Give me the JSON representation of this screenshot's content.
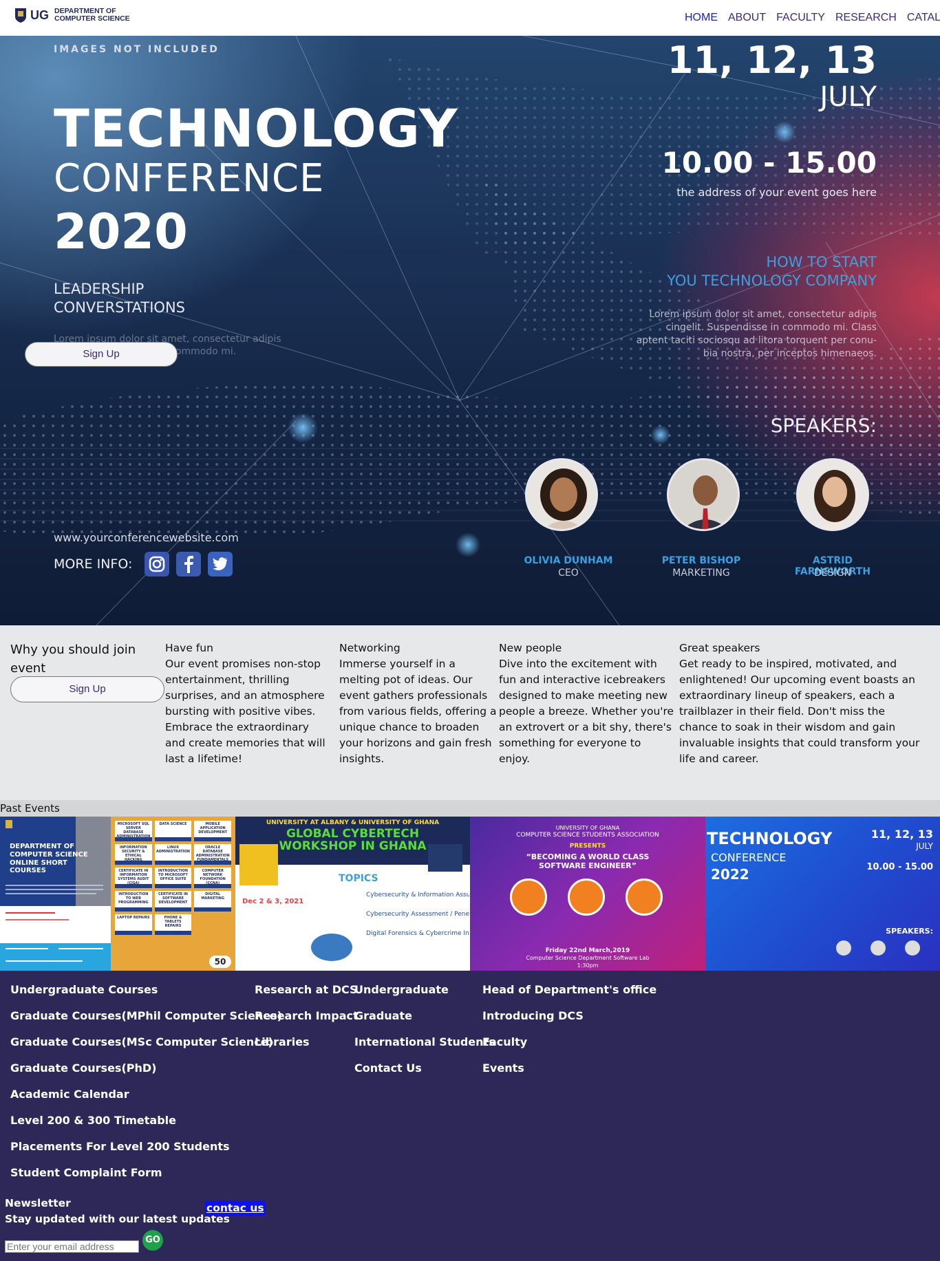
{
  "nav": {
    "logo_ug": "UG",
    "logo_line1": "DEPARTMENT OF",
    "logo_line2": "COMPUTER SCIENCE",
    "links": [
      "HOME",
      "ABOUT",
      "FACULTY",
      "RESEARCH",
      "CATALOG"
    ]
  },
  "hero": {
    "images_not_included": "IMAGES NOT INCLUDED",
    "title_1": "TECHNOLOGY",
    "title_2": "CONFERENCE",
    "title_3": "2020",
    "leadership": "LEADERSHIP\nCONVERSTATIONS",
    "ghost_text": "Lorem ipsum dolor sit amet, consectetur adipis\ncingelit. Suspendisse in commodo mi.",
    "signup_label": "Sign Up",
    "dates": "11, 12, 13",
    "month": "JULY",
    "time": "10.00 - 15.00",
    "address": "the address of your event goes here",
    "howto": "HOW TO START\nYOU TECHNOLOGY COMPANY",
    "lorem": "Lorem ipsum dolor sit amet, consectetur adipis\ncingelit. Suspendisse in commodo mi. Class\naptent taciti sociosqu ad litora torquent per conu-\nbia nostra, per inceptos himenaeos.",
    "speakers_heading": "SPEAKERS:",
    "speakers": [
      {
        "name": "OLIVIA DUNHAM",
        "role": "CEO"
      },
      {
        "name": "PETER BISHOP",
        "role": "MARKETING"
      },
      {
        "name": "ASTRID FARNSWORTH",
        "role": "DESIGN"
      }
    ],
    "website": "www.yourconferencewebsite.com",
    "more_info": "MORE INFO:"
  },
  "why": {
    "title": "Why you should join event",
    "signup_label": "Sign Up",
    "columns": [
      {
        "heading": "Have fun",
        "body": "Our event promises non-stop entertainment, thrilling surprises, and an atmosphere bursting with positive vibes. Embrace the extraordinary and create memories that will last a lifetime!"
      },
      {
        "heading": "Networking",
        "body": "Immerse yourself in a melting pot of ideas. Our event gathers professionals from various fields, offering a unique chance to broaden your horizons and gain fresh insights."
      },
      {
        "heading": "New people",
        "body": "Dive into the excitement with fun and interactive icebreakers designed to make meeting new people a breeze. Whether you're an extrovert or a bit shy, there's something for everyone to enjoy."
      },
      {
        "heading": "Great speakers",
        "body": "Get ready to be inspired, motivated, and enlightened! Our upcoming event boasts an extraordinary lineup of speakers, each a trailblazer in their field. Don't miss the chance to soak in their wisdom and gain invaluable insights that could transform your life and career."
      }
    ]
  },
  "past_events": {
    "label": "Past Events",
    "tile1": {
      "header": "DEPARTMENT OF COMPUTER SCIENCE",
      "sub": "ONLINE SHORT COURSES"
    },
    "tile2": {
      "cells": [
        "MICROSOFT SQL SERVER DATABASE ADMINISTRATION",
        "DATA SCIENCE",
        "MOBILE APPLICATION DEVELOPMENT",
        "INFORMATION SECURITY & ETHICAL HACKING",
        "LINUX ADMINISTRATION",
        "ORACLE DATABASE ADMINISTRATION FUNDAMENTALS",
        "CERTIFICATE IN INFORMATION SYSTEMS AUDIT (CISA)",
        "INTRODUCTION TO MICROSOFT OFFICE SUITE",
        "COMPUTER NETWORK FOUNDATION (CCNA)",
        "INTRODUCTION TO WEB PROGRAMMING",
        "CERTIFICATE IN SOFTWARE DEVELOPMENT",
        "DIGITAL MARKETING",
        "LAPTOP REPAIRS",
        "PHONE & TABLETS REPAIRS"
      ],
      "badge": "50"
    },
    "tile3": {
      "header": "UNIVERSITY AT ALBANY & UNIVERSITY OF GHANA",
      "title_1": "GLOBAL CYBERTECH",
      "title_2": "WORKSHOP IN GHANA",
      "topics": "TOPICS",
      "dates": "Dec 2 & 3, 2021",
      "topic_list": [
        "Cybersecurity & Information Assurance",
        "Cybersecurity Assessment / Penetration Testing",
        "Digital Forensics & Cybercrime Investigation"
      ]
    },
    "tile4": {
      "header": "UNIVERSITY OF GHANA",
      "sub": "COMPUTER SCIENCE STUDENTS ASSOCIATION",
      "presents": "PRESENTS",
      "title": "“BECOMING A WORLD CLASS SOFTWARE ENGINEER”",
      "date": "Friday 22nd March,2019",
      "venue": "Computer Science Department Software Lab",
      "time": "1:30pm"
    },
    "tile5": {
      "title_1": "TECHNOLOGY",
      "title_2": "CONFERENCE",
      "title_3": "2022",
      "dates": "11, 12, 13",
      "month": "JULY",
      "time": "10.00 - 15.00",
      "speakers": "SPEAKERS:"
    }
  },
  "footer": {
    "col1": [
      "Undergraduate Courses",
      "Graduate Courses(MPhil Computer Science)",
      "Graduate Courses(MSc Computer Science)",
      "Graduate Courses(PhD)",
      "Academic Calendar",
      "Level 200 & 300 Timetable",
      "Placements For Level 200 Students",
      "Student Complaint Form"
    ],
    "col2": [
      "Research at DCS",
      "Research Impact",
      "Libraries"
    ],
    "col3": [
      "Undergraduate",
      "Graduate",
      "International Students",
      "Contact Us"
    ],
    "col4": [
      "Head of Department's office",
      "Introducing DCS",
      "Faculty",
      "Events"
    ],
    "newsletter": "Newsletter",
    "newsletter_sub": "Stay updated with our latest updates",
    "contact": "contac us",
    "email_placeholder": "Enter your email address",
    "go": "GO"
  },
  "colors": {
    "accent": "#3aa0e0",
    "footer_bg": "#2e2858",
    "nav_link": "#3b2a7a",
    "nav_active": "#1a1fb8",
    "go_button": "#1fa04a"
  }
}
